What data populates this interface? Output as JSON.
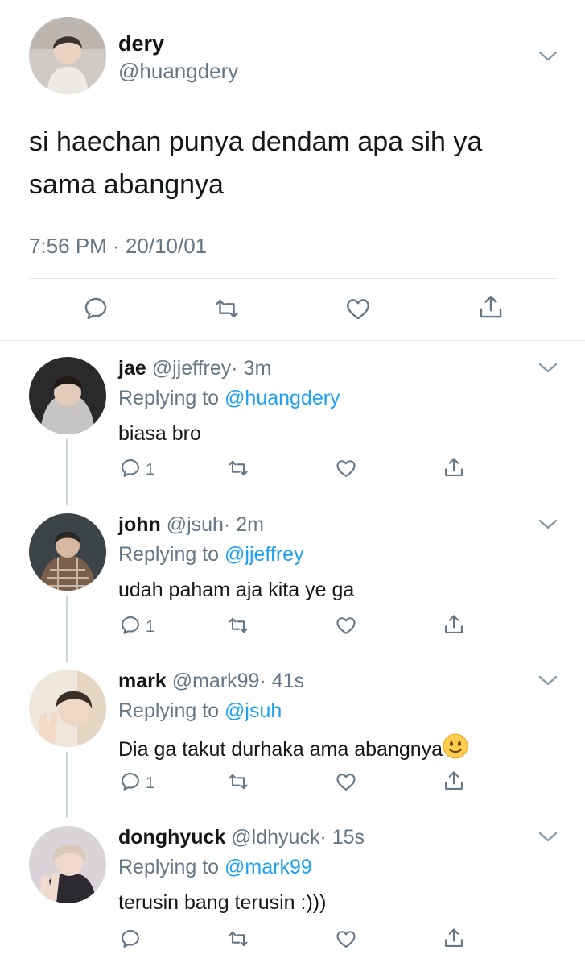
{
  "main": {
    "name": "dery",
    "handle": "@huangdery",
    "text": "si haechan punya dendam apa sih ya sama abangnya",
    "time": "7:56 PM · 20/10/01"
  },
  "actions": {
    "reply_icon": "reply-icon",
    "retweet_icon": "retweet-icon",
    "like_icon": "heart-icon",
    "share_icon": "share-icon"
  },
  "replies": [
    {
      "name": "jae",
      "handle": "@jjeffrey",
      "time": "· 3m",
      "replying_label": "Replying to",
      "replying_to": "@huangdery",
      "text": "biasa bro",
      "reply_count": "1"
    },
    {
      "name": "john",
      "handle": "@jsuh",
      "time": "· 2m",
      "replying_label": "Replying to",
      "replying_to": "@jjeffrey",
      "text": "udah paham aja kita ye ga",
      "reply_count": "1"
    },
    {
      "name": "mark",
      "handle": "@mark99",
      "time": "· 41s",
      "replying_label": "Replying to",
      "replying_to": "@jsuh",
      "text": "Dia ga takut durhaka ama abangnya",
      "reply_count": "1"
    },
    {
      "name": "donghyuck",
      "handle": "@ldhyuck",
      "time": "· 15s",
      "replying_label": "Replying to",
      "replying_to": "@mark99",
      "text": "terusin bang terusin :)))",
      "reply_count": ""
    }
  ],
  "colors": {
    "link": "#1da1f2",
    "secondary": "#657786",
    "divider": "#e1e8ed"
  }
}
